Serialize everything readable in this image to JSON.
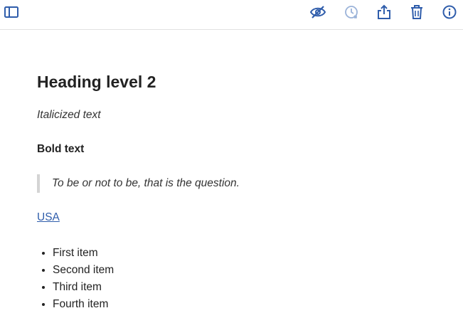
{
  "toolbar": {
    "accent_color": "#2f5dab",
    "disabled_color": "#9bb3d9",
    "left_icons": [
      "sidebar-toggle-icon"
    ],
    "right_icons": [
      "eye-slash-icon",
      "history-icon",
      "share-icon",
      "trash-icon",
      "info-icon"
    ]
  },
  "document": {
    "heading": "Heading level 2",
    "italic_text": "Italicized text",
    "bold_text": "Bold text",
    "blockquote": "To be or not to be, that is the question.",
    "link_text": "USA",
    "list_items": [
      "First item",
      "Second item",
      "Third item",
      "Fourth item"
    ]
  }
}
